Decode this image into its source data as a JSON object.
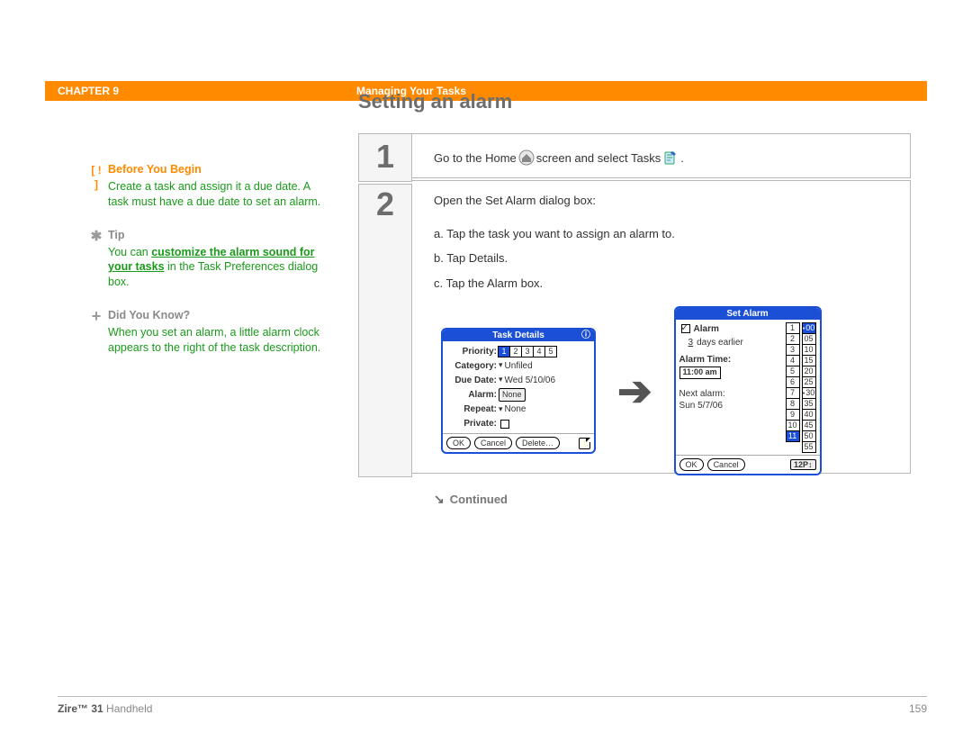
{
  "header": {
    "chapter": "CHAPTER 9",
    "title": "Managing Your Tasks"
  },
  "sidebar": {
    "before": {
      "icon": "[ ! ]",
      "heading": "Before You Begin",
      "body_pre": "Create a task and assign it a due date. A task must have a due date to set an alarm."
    },
    "tip": {
      "icon": "✱",
      "heading": "Tip",
      "body_pre": "You can ",
      "link": "customize the alarm sound for your tasks",
      "body_post": " in the Task Preferences dialog box."
    },
    "dyk": {
      "icon": "+",
      "heading": "Did You Know?",
      "body": "When you set an alarm, a little alarm clock appears to the right of the task description."
    }
  },
  "main": {
    "title": "Setting an alarm",
    "step1": {
      "num": "1",
      "text_pre": "Go to the Home ",
      "text_mid": " screen and select Tasks ",
      "text_post": "."
    },
    "step2": {
      "num": "2",
      "lead": "Open the Set Alarm dialog box:",
      "a": "a.  Tap the task you want to assign an alarm to.",
      "b": "b.  Tap Details.",
      "c": "c.  Tap the Alarm box."
    },
    "continued": "Continued"
  },
  "task_details": {
    "title": "Task Details",
    "priority_label": "Priority:",
    "priority_values": [
      "1",
      "2",
      "3",
      "4",
      "5"
    ],
    "priority_selected": "1",
    "category_label": "Category:",
    "category_value": "Unfiled",
    "duedate_label": "Due Date:",
    "duedate_value": "Wed 5/10/06",
    "alarm_label": "Alarm:",
    "alarm_value": "None",
    "repeat_label": "Repeat:",
    "repeat_value": "None",
    "private_label": "Private:",
    "ok": "OK",
    "cancel": "Cancel",
    "delete": "Delete…"
  },
  "set_alarm": {
    "title": "Set Alarm",
    "alarm_checked_label": "Alarm",
    "days_value": "3",
    "days_suffix": "days earlier",
    "alarm_time_label": "Alarm Time:",
    "alarm_time_value": "11:00 am",
    "next_alarm_label": "Next alarm:",
    "next_alarm_value": "Sun 5/7/06",
    "ok": "OK",
    "cancel": "Cancel",
    "hours": [
      "1",
      "2",
      "3",
      "4",
      "5",
      "6",
      "7",
      "8",
      "9",
      "10",
      "11"
    ],
    "hour_selected": "11",
    "minutes": [
      "00",
      "05",
      "10",
      "15",
      "20",
      "25",
      "30",
      "35",
      "40",
      "45",
      "50",
      "55"
    ],
    "minute_selected": "00",
    "ampm": "12P"
  },
  "footer": {
    "product_bold": "Zire™ 31",
    "product_rest": " Handheld",
    "page": "159"
  }
}
